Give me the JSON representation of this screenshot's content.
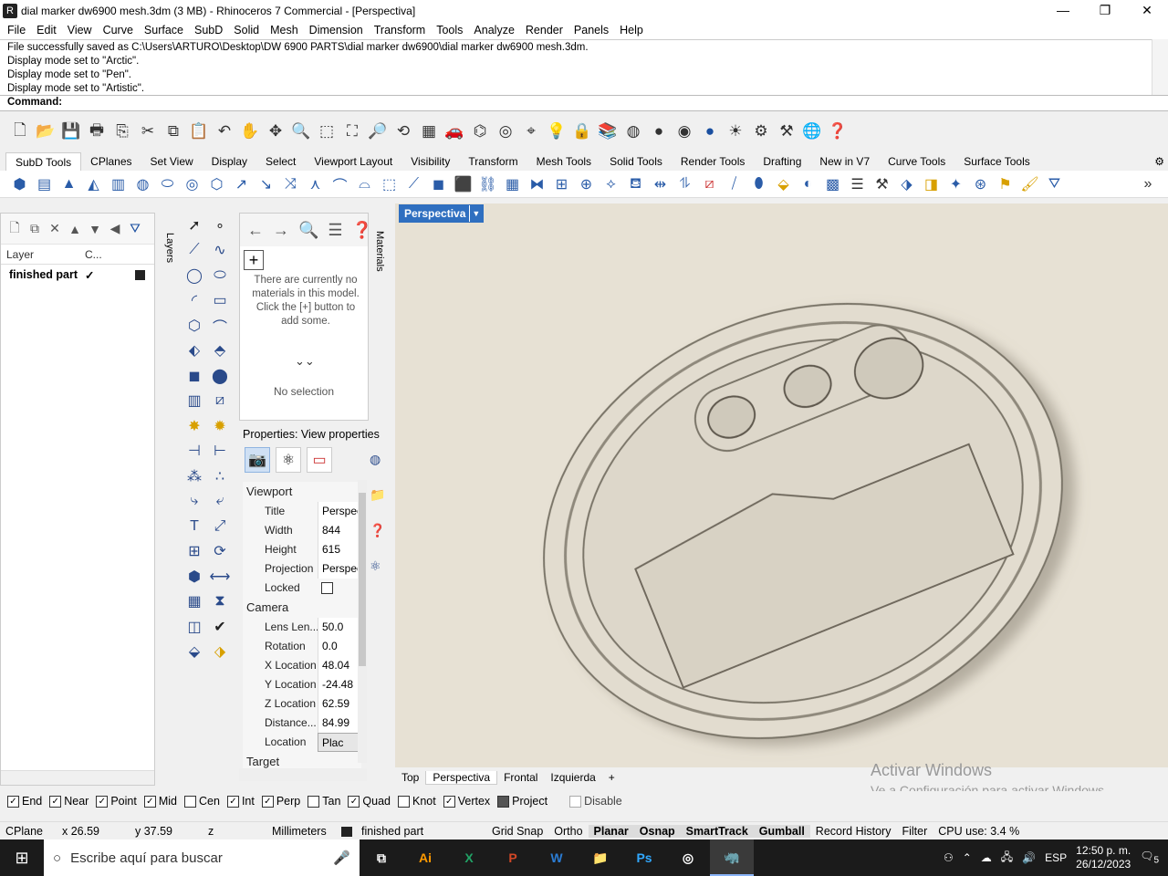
{
  "window": {
    "title": "dial marker dw6900 mesh.3dm (3 MB) - Rhinoceros 7 Commercial - [Perspectiva]",
    "minimize": "—",
    "maximize": "❐",
    "close": "✕"
  },
  "menu": [
    "File",
    "Edit",
    "View",
    "Curve",
    "Surface",
    "SubD",
    "Solid",
    "Mesh",
    "Dimension",
    "Transform",
    "Tools",
    "Analyze",
    "Render",
    "Panels",
    "Help"
  ],
  "command_history": [
    "File successfully saved as C:\\Users\\ARTURO\\Desktop\\DW 6900 PARTS\\dial marker dw6900\\dial marker dw6900 mesh.3dm.",
    "Display mode set to \"Arctic\".",
    "Display mode set to \"Pen\".",
    "Display mode set to \"Artistic\"."
  ],
  "command_prompt": "Command:",
  "toolbar_tabs": [
    "SubD Tools",
    "CPlanes",
    "Set View",
    "Display",
    "Select",
    "Viewport Layout",
    "Visibility",
    "Transform",
    "Mesh Tools",
    "Solid Tools",
    "Render Tools",
    "Drafting",
    "New in V7",
    "Curve Tools",
    "Surface Tools"
  ],
  "layers": {
    "tab_label": "Layers",
    "col_layer": "Layer",
    "col_current": "C...",
    "rows": [
      {
        "name": "finished part",
        "current": "✓"
      }
    ]
  },
  "materials": {
    "tab_label": "Materials",
    "add": "+",
    "message": "There are currently no materials in this model. Click the [+] button to add some.",
    "no_selection": "No selection"
  },
  "properties": {
    "title": "Properties: View properties",
    "sections": {
      "viewport": "Viewport",
      "camera": "Camera",
      "target": "Target"
    },
    "viewport_rows": [
      {
        "k": "Title",
        "v": "Perspec"
      },
      {
        "k": "Width",
        "v": "844"
      },
      {
        "k": "Height",
        "v": "615"
      },
      {
        "k": "Projection",
        "v": "Perspec"
      }
    ],
    "locked_label": "Locked",
    "camera_rows": [
      {
        "k": "Lens Len...",
        "v": "50.0"
      },
      {
        "k": "Rotation",
        "v": "0.0"
      },
      {
        "k": "X Location",
        "v": "48.04"
      },
      {
        "k": "Y Location",
        "v": "-24.48"
      },
      {
        "k": "Z Location",
        "v": "62.59"
      },
      {
        "k": "Distance...",
        "v": "84.99"
      }
    ],
    "location_label": "Location",
    "location_button": "Plac"
  },
  "viewport": {
    "active_label": "Perspectiva",
    "tabs": [
      "Top",
      "Perspectiva",
      "Frontal",
      "Izquierda"
    ],
    "add_tab": "+"
  },
  "watermark": {
    "line1": "Activar Windows",
    "line2": "Ve a Configuración para activar Windows."
  },
  "osnaps": [
    {
      "label": "End",
      "checked": true
    },
    {
      "label": "Near",
      "checked": true
    },
    {
      "label": "Point",
      "checked": true
    },
    {
      "label": "Mid",
      "checked": true
    },
    {
      "label": "Cen",
      "checked": false
    },
    {
      "label": "Int",
      "checked": true
    },
    {
      "label": "Perp",
      "checked": true
    },
    {
      "label": "Tan",
      "checked": false
    },
    {
      "label": "Quad",
      "checked": true
    },
    {
      "label": "Knot",
      "checked": false
    },
    {
      "label": "Vertex",
      "checked": true
    }
  ],
  "osnap_project": "Project",
  "osnap_disable": "Disable",
  "status": {
    "cplane": "CPlane",
    "x": "x 26.59",
    "y": "y 37.59",
    "z": "z",
    "units": "Millimeters",
    "layer": "finished part",
    "grid_snap": "Grid Snap",
    "ortho": "Ortho",
    "planar": "Planar",
    "osnap": "Osnap",
    "smarttrack": "SmartTrack",
    "gumball": "Gumball",
    "record_history": "Record History",
    "filter": "Filter",
    "cpu": "CPU use: 3.4 %"
  },
  "taskbar": {
    "search_placeholder": "Escribe aquí para buscar",
    "lang": "ESP",
    "time": "12:50 p. m.",
    "date": "26/12/2023",
    "notifications": "5",
    "apps": [
      "Ai",
      "X",
      "P",
      "W",
      "📁",
      "Ps",
      "◎",
      "🦏"
    ]
  }
}
